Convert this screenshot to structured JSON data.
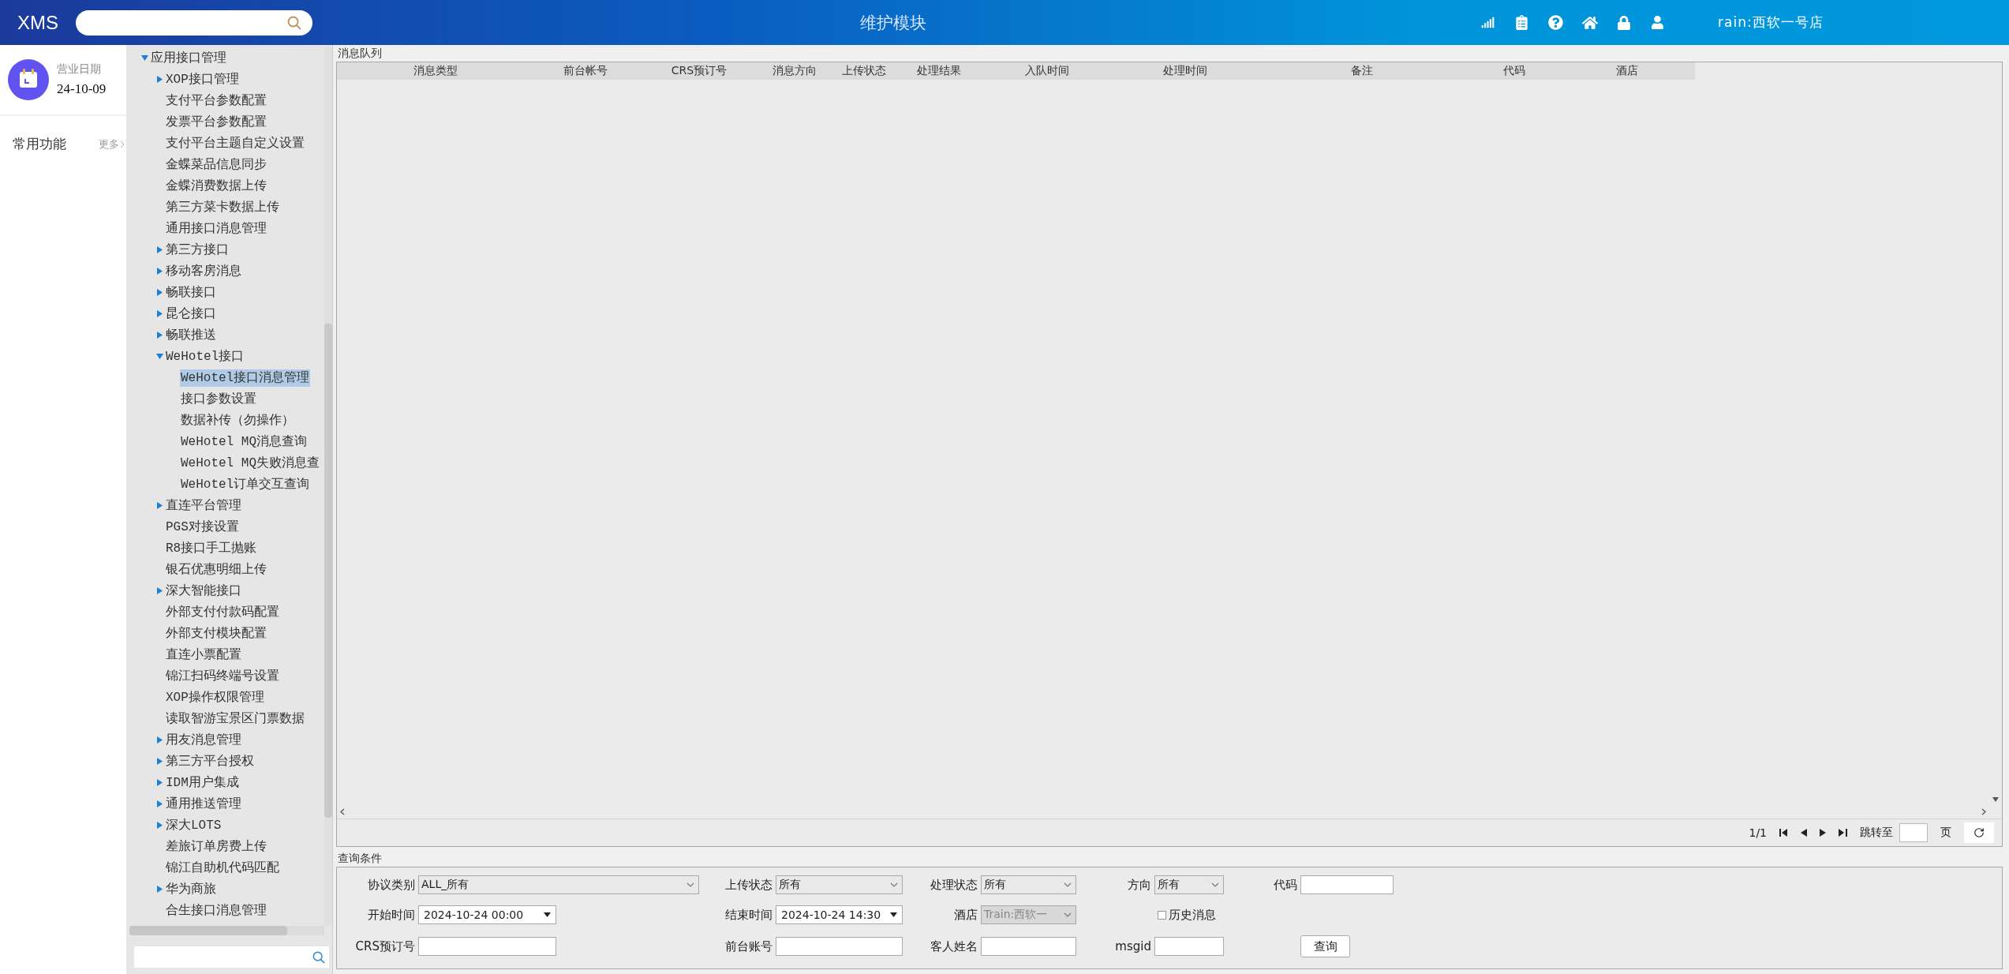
{
  "header": {
    "app_name": "XMS",
    "title": "维护模块",
    "user": "rain:西软一号店"
  },
  "business_date": {
    "label": "营业日期",
    "value": "24-10-09"
  },
  "favorites": {
    "title": "常用功能",
    "more": "更多"
  },
  "tree": [
    {
      "label": "应用接口管理",
      "expanded": true,
      "selected": false,
      "children": [
        {
          "label": "XOP接口管理",
          "expanded": false,
          "selected": false
        },
        {
          "label": "支付平台参数配置",
          "selected": false
        },
        {
          "label": "发票平台参数配置",
          "selected": false
        },
        {
          "label": "支付平台主题自定义设置",
          "selected": false
        },
        {
          "label": "金蝶菜品信息同步",
          "selected": false
        },
        {
          "label": "金蝶消费数据上传",
          "selected": false
        },
        {
          "label": "第三方菜卡数据上传",
          "selected": false
        },
        {
          "label": "通用接口消息管理",
          "selected": false
        },
        {
          "label": "第三方接口",
          "expanded": false,
          "selected": false
        },
        {
          "label": "移动客房消息",
          "expanded": false,
          "selected": false
        },
        {
          "label": "畅联接口",
          "expanded": false,
          "selected": false
        },
        {
          "label": "昆仑接口",
          "expanded": false,
          "selected": false
        },
        {
          "label": "畅联推送",
          "expanded": false,
          "selected": false
        },
        {
          "label": "WeHotel接口",
          "expanded": true,
          "selected": false,
          "children": [
            {
              "label": "WeHotel接口消息管理",
              "selected": true
            },
            {
              "label": "接口参数设置",
              "selected": false
            },
            {
              "label": "数据补传（勿操作）",
              "selected": false
            },
            {
              "label": "WeHotel MQ消息查询",
              "selected": false
            },
            {
              "label": "WeHotel MQ失败消息查",
              "selected": false
            },
            {
              "label": "WeHotel订单交互查询",
              "selected": false
            }
          ]
        },
        {
          "label": "直连平台管理",
          "expanded": false,
          "selected": false
        },
        {
          "label": "PGS对接设置",
          "selected": false
        },
        {
          "label": "R8接口手工抛账",
          "selected": false
        },
        {
          "label": "银石优惠明细上传",
          "selected": false
        },
        {
          "label": "深大智能接口",
          "expanded": false,
          "selected": false
        },
        {
          "label": "外部支付付款码配置",
          "selected": false
        },
        {
          "label": "外部支付模块配置",
          "selected": false
        },
        {
          "label": "直连小票配置",
          "selected": false
        },
        {
          "label": "锦江扫码终端号设置",
          "selected": false
        },
        {
          "label": "XOP操作权限管理",
          "selected": false
        },
        {
          "label": "读取智游宝景区门票数据",
          "selected": false
        },
        {
          "label": "用友消息管理",
          "expanded": false,
          "selected": false
        },
        {
          "label": "第三方平台授权",
          "expanded": false,
          "selected": false
        },
        {
          "label": "IDM用户集成",
          "expanded": false,
          "selected": false
        },
        {
          "label": "通用推送管理",
          "expanded": false,
          "selected": false
        },
        {
          "label": "深大LOTS",
          "expanded": false,
          "selected": false
        },
        {
          "label": "差旅订单房费上传",
          "selected": false
        },
        {
          "label": "锦江自助机代码匹配",
          "selected": false
        },
        {
          "label": "华为商旅",
          "expanded": false,
          "selected": false
        },
        {
          "label": "合生接口消息管理",
          "selected": false
        }
      ]
    }
  ],
  "queue": {
    "title": "消息队列",
    "columns": [
      "消息类型",
      "前台帐号",
      "CRS预订号",
      "消息方向",
      "上传状态",
      "处理结果",
      "入队时间",
      "处理时间",
      "备注",
      "代码",
      "酒店"
    ],
    "pagination": {
      "page": "1/1",
      "jump_label": "跳转至",
      "unit": "页"
    }
  },
  "query": {
    "title": "查询条件",
    "rows": [
      [
        {
          "kind": "select",
          "label": "协议类别",
          "value": "ALL_所有",
          "disabled": false
        },
        {
          "kind": "select",
          "label": "上传状态",
          "value": "所有",
          "disabled": false
        },
        {
          "kind": "select",
          "label": "处理状态",
          "value": "所有",
          "disabled": false
        },
        {
          "kind": "select",
          "label": "方向",
          "value": "所有",
          "disabled": false
        },
        {
          "kind": "text",
          "label": "代码"
        }
      ],
      [
        {
          "kind": "datetime",
          "label": "开始时间",
          "value": "2024-10-24 00:00"
        },
        {
          "kind": "datetime",
          "label": "结束时间",
          "value": "2024-10-24 14:30"
        },
        {
          "kind": "select",
          "label": "酒店",
          "value": "Train:西软一",
          "disabled": true
        },
        {
          "kind": "checkbox",
          "label": "历史消息",
          "checked": false
        }
      ],
      [
        {
          "kind": "text",
          "label": "CRS预订号"
        },
        {
          "kind": "text",
          "label": "前台账号"
        },
        {
          "kind": "text",
          "label": "客人姓名"
        },
        {
          "kind": "text",
          "label": "msgid"
        },
        {
          "kind": "button",
          "label": "查询"
        }
      ]
    ]
  }
}
